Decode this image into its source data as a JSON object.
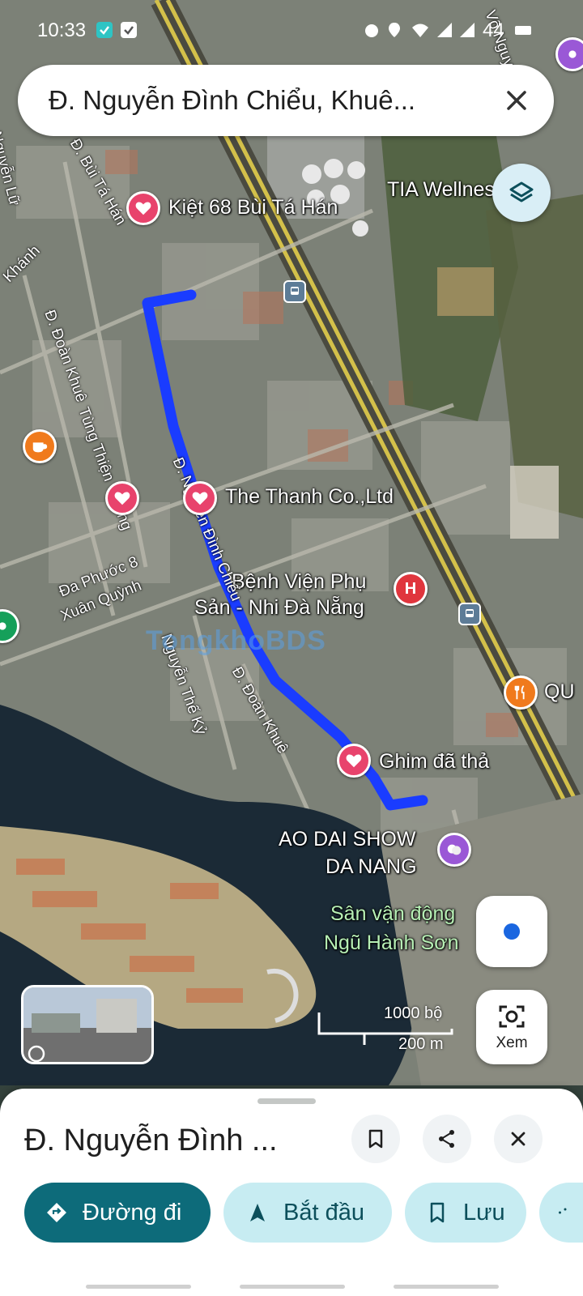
{
  "status_bar": {
    "time": "10:33",
    "battery": "44"
  },
  "search": {
    "query": "Đ. Nguyễn Đình Chiểu, Khuê..."
  },
  "map": {
    "labels": {
      "kiet68": "Kiệt 68 Bùi Tá Hán",
      "tia": "TIA Wellness",
      "thanh_co": "The Thanh Co.,Ltd",
      "benh_vien_1": "Bệnh Viện Phụ",
      "benh_vien_2": "Sản - Nhi Đà Nẵng",
      "ghim": "Ghim đã thả",
      "ao_dai_1": "AO DAI SHOW",
      "ao_dai_2": "DA NANG",
      "san_1": "Sân vận động",
      "san_2": "Ngũ Hành Sơn",
      "qu": "QU"
    },
    "streets": {
      "doan_khue_top": "Đ. Đoàn Khuê",
      "tung_thien": "Tùng Thiện Vương",
      "phuoc8": "Đa Phước 8",
      "xuan_quynh": "Xuân Quỳnh",
      "nguyen_the_ky": "Nguyễn Thế Kỷ",
      "doan_khue_bottom": "Đ. Đoàn Khuê",
      "nguyen_dinh_chieu": "Đ. Nguyễn Đình Chiểu",
      "bui_ta_han": "Đ. Bùi Tá Hán",
      "nguyen_lu": "Nguyễn Lữ",
      "khanh": "Khánh",
      "vo_nguyen": "Võ Nguyên Giáp"
    },
    "watermark_a": "Tongkho",
    "watermark_b": "BDS",
    "scale": {
      "feet": "1000 bộ",
      "meters": "200 m"
    },
    "lens_label": "Xem"
  },
  "sheet": {
    "title": "Đ. Nguyễn Đình ...",
    "actions": {
      "directions": "Đường đi",
      "start": "Bắt đầu",
      "save": "Lưu"
    }
  },
  "colors": {
    "route": "#1a3cff",
    "primary": "#0d6b7a",
    "secondary": "#c7ecf2",
    "favorite_pin": "#e8436c"
  }
}
